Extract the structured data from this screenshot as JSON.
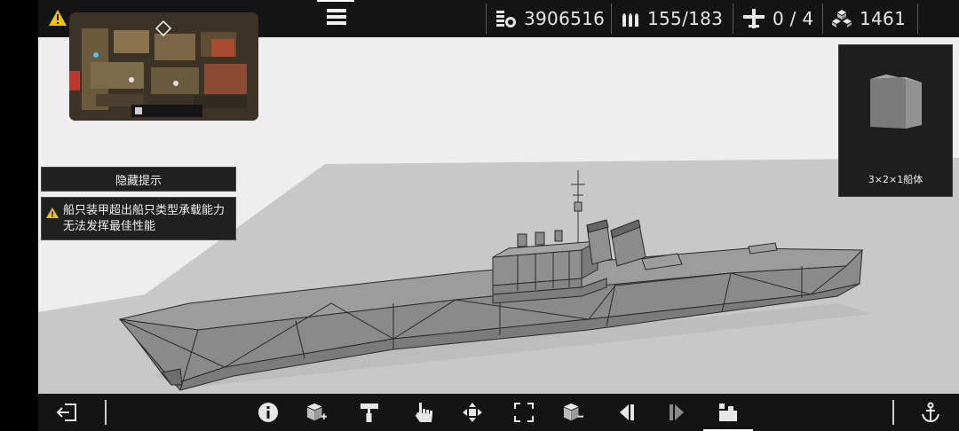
{
  "topbar": {
    "credits": "3906516",
    "ammo": "155/183",
    "aircraft": "0 / 4",
    "materials": "1461",
    "help_label": "?"
  },
  "tips": {
    "hide_label": "隐藏提示",
    "warning_text": "船只装甲超出船只类型承载能力无法发挥最佳性能"
  },
  "part": {
    "label": "3×2×1船体"
  },
  "icons": {
    "warning": "warning-icon",
    "menu": "hamburger-menu-icon",
    "credits": "coin-stack-icon",
    "ammo": "shells-icon",
    "aircraft": "plane-icon",
    "materials": "cubes-icon",
    "help": "help-icon",
    "exit": "exit-icon",
    "info": "info-icon",
    "add_block": "add-block-icon",
    "paint": "paint-roller-icon",
    "hand": "hand-icon",
    "move": "move-arrows-icon",
    "resize": "resize-frame-icon",
    "remove_block": "remove-block-icon",
    "prev": "prev-icon",
    "next": "next-icon",
    "parts": "parts-icon",
    "anchor": "anchor-icon"
  },
  "colors": {
    "bar_bg": "#141414",
    "viewport_bg": "#eeeeee",
    "floor": "#c9c9c9",
    "hull": "#8d8d8d",
    "warning_yellow": "#f5c400"
  }
}
